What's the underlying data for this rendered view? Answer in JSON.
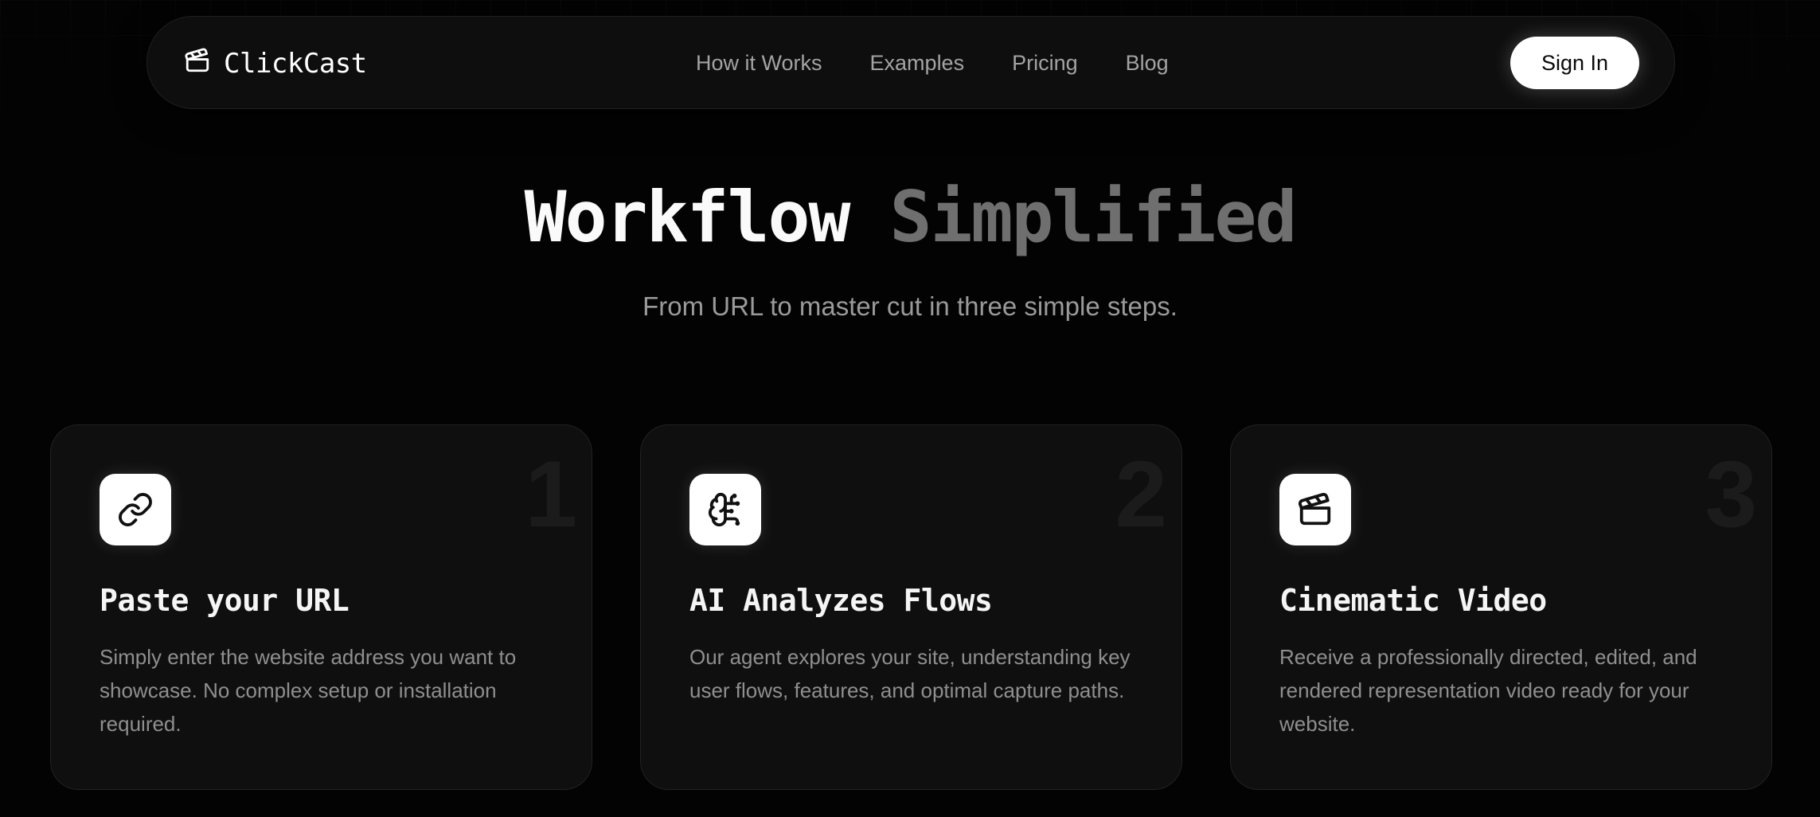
{
  "nav": {
    "brand": "ClickCast",
    "brand_icon": "clapperboard-icon",
    "links": [
      "How it Works",
      "Examples",
      "Pricing",
      "Blog"
    ],
    "signin_label": "Sign In"
  },
  "hero": {
    "title_primary": "Workflow",
    "title_secondary": "Simplified",
    "subtitle": "From URL to master cut in three simple steps."
  },
  "steps": [
    {
      "number": "1",
      "icon": "link-icon",
      "title": "Paste your URL",
      "description": "Simply enter the website address you want to showcase. No complex setup or installation required."
    },
    {
      "number": "2",
      "icon": "brain-circuit-icon",
      "title": "AI Analyzes Flows",
      "description": "Our agent explores your site, understanding key user flows, features, and optimal capture paths."
    },
    {
      "number": "3",
      "icon": "clapperboard-icon",
      "title": "Cinematic Video",
      "description": "Receive a professionally directed, edited, and rendered representation video ready for your website."
    }
  ],
  "colors": {
    "background": "#030303",
    "card": "#0f0f0f",
    "accent": "#ffffff",
    "muted_text": "#8f8f8f",
    "title_secondary": "#6f6f6f"
  }
}
